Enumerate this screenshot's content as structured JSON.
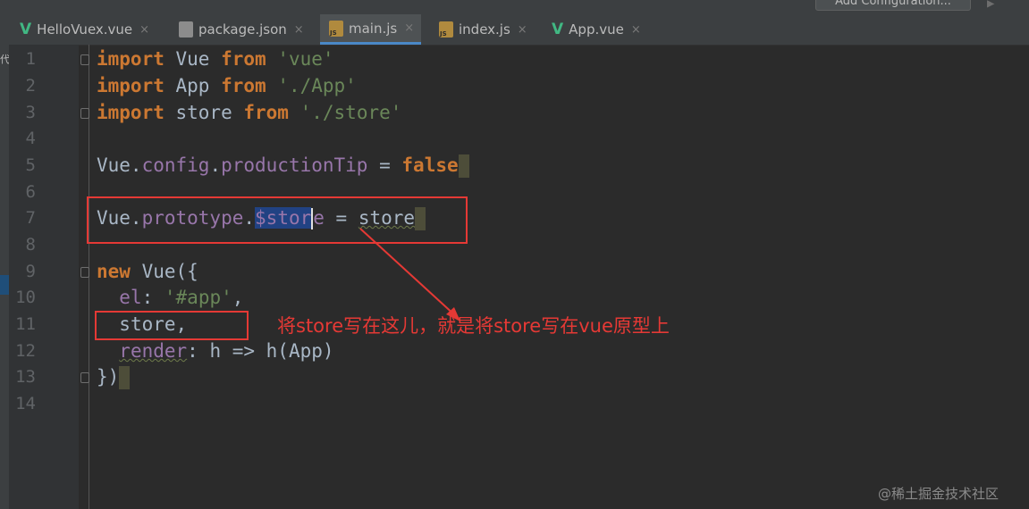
{
  "toolbar": {
    "config_label": "Add Configuration..."
  },
  "tabs": [
    {
      "label": "HelloVuex.vue",
      "icon": "vue-file-icon"
    },
    {
      "label": "package.json",
      "icon": "json-file-icon"
    },
    {
      "label": "main.js",
      "icon": "js-file-icon",
      "active": true
    },
    {
      "label": "index.js",
      "icon": "js-file-icon"
    },
    {
      "label": "App.vue",
      "icon": "vue-file-icon"
    }
  ],
  "close_glyph": "×",
  "left_mark": "代",
  "line_numbers": [
    "1",
    "2",
    "3",
    "4",
    "5",
    "6",
    "7",
    "8",
    "9",
    "10",
    "11",
    "12",
    "13",
    "14"
  ],
  "code": {
    "l1": {
      "kw1": "import",
      "ident": " Vue ",
      "kw2": "from",
      "sp": " ",
      "str": "'vue'"
    },
    "l2": {
      "kw1": "import",
      "ident": " App ",
      "kw2": "from",
      "sp": " ",
      "str": "'./App'"
    },
    "l3": {
      "kw1": "import",
      "ident": " store ",
      "kw2": "from",
      "sp": " ",
      "str": "'./store'"
    },
    "l5": {
      "obj": "Vue.",
      "p1": "config",
      "dot": ".",
      "p2": "productionTip",
      "eq": " = ",
      "kw": "false"
    },
    "l7": {
      "obj": "Vue.",
      "p1": "prototype",
      "dot": ".",
      "sel": "$stor",
      "rest": "e",
      "eq": " = ",
      "val": "store"
    },
    "l9": {
      "kw": "new",
      "rest": " Vue({"
    },
    "l10": {
      "indent": "  ",
      "key": "el",
      "colon": ": ",
      "str": "'#app'",
      "comma": ","
    },
    "l11": {
      "indent": "  ",
      "val": "store",
      "comma": ","
    },
    "l12": {
      "indent": "  ",
      "key": "render",
      "rest": ": h => h(App)"
    },
    "l13": {
      "text": "})"
    }
  },
  "annotation": "将store写在这儿，就是将store写在vue原型上",
  "watermark": "@稀土掘金技术社区",
  "colors": {
    "annotation": "#e53935",
    "keyword": "#cc7832",
    "string": "#6a8759",
    "property": "#9876aa",
    "vue_icon": "#41b883"
  }
}
